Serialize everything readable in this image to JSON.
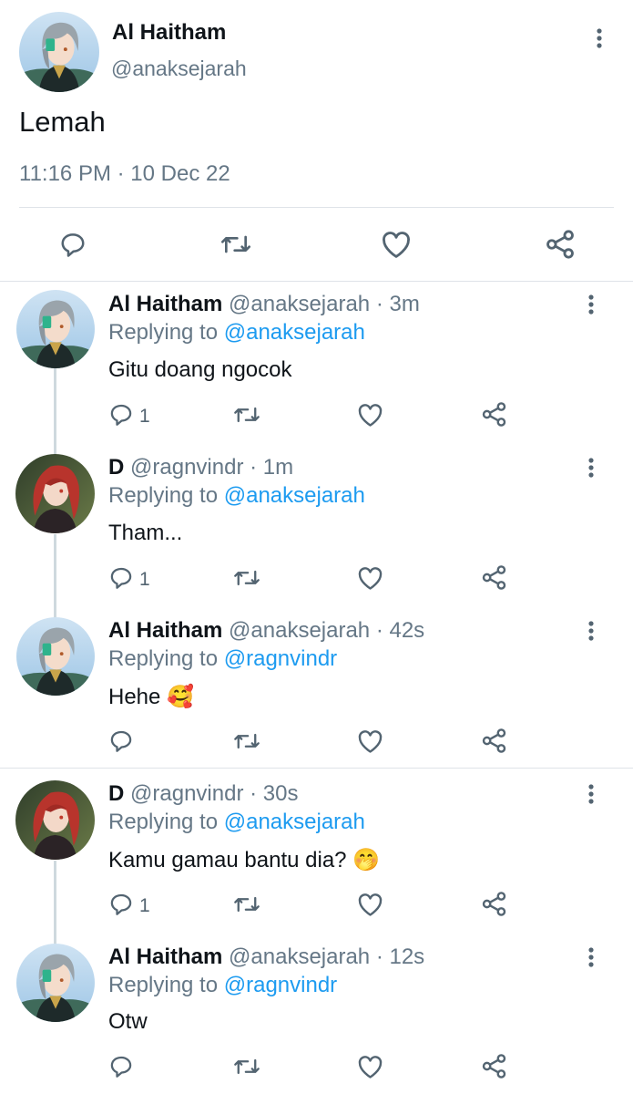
{
  "main_tweet": {
    "name": "Al Haitham",
    "handle": "@anaksejarah",
    "text": "Lemah",
    "meta": "11:16 PM · 10 Dec 22"
  },
  "replies": [
    {
      "name": "Al Haitham",
      "handle_time": "@anaksejarah · 3m",
      "replying_prefix": "Replying to ",
      "replying_to": "@anaksejarah",
      "text": "Gitu doang ngocok",
      "reply_count": "1"
    },
    {
      "name": "D",
      "handle_time": "@ragnvindr · 1m",
      "replying_prefix": "Replying to ",
      "replying_to": "@anaksejarah",
      "text": "Tham...",
      "reply_count": "1"
    },
    {
      "name": "Al Haitham",
      "handle_time": "@anaksejarah · 42s",
      "replying_prefix": "Replying to ",
      "replying_to": "@ragnvindr",
      "text": "Hehe 🥰",
      "reply_count": ""
    },
    {
      "name": "D",
      "handle_time": "@ragnvindr · 30s",
      "replying_prefix": "Replying to ",
      "replying_to": "@anaksejarah",
      "text": "Kamu gamau bantu dia? 🤭",
      "reply_count": "1"
    },
    {
      "name": "Al Haitham",
      "handle_time": "@anaksejarah · 12s",
      "replying_prefix": "Replying to ",
      "replying_to": "@ragnvindr",
      "text": "Otw",
      "reply_count": ""
    }
  ],
  "colors": {
    "link": "#1d9bf0",
    "muted": "#657786",
    "icon": "#536471",
    "divider": "#dfe3e8"
  },
  "icons": [
    "reply-icon",
    "retweet-icon",
    "like-icon",
    "share-icon",
    "more-icon"
  ]
}
